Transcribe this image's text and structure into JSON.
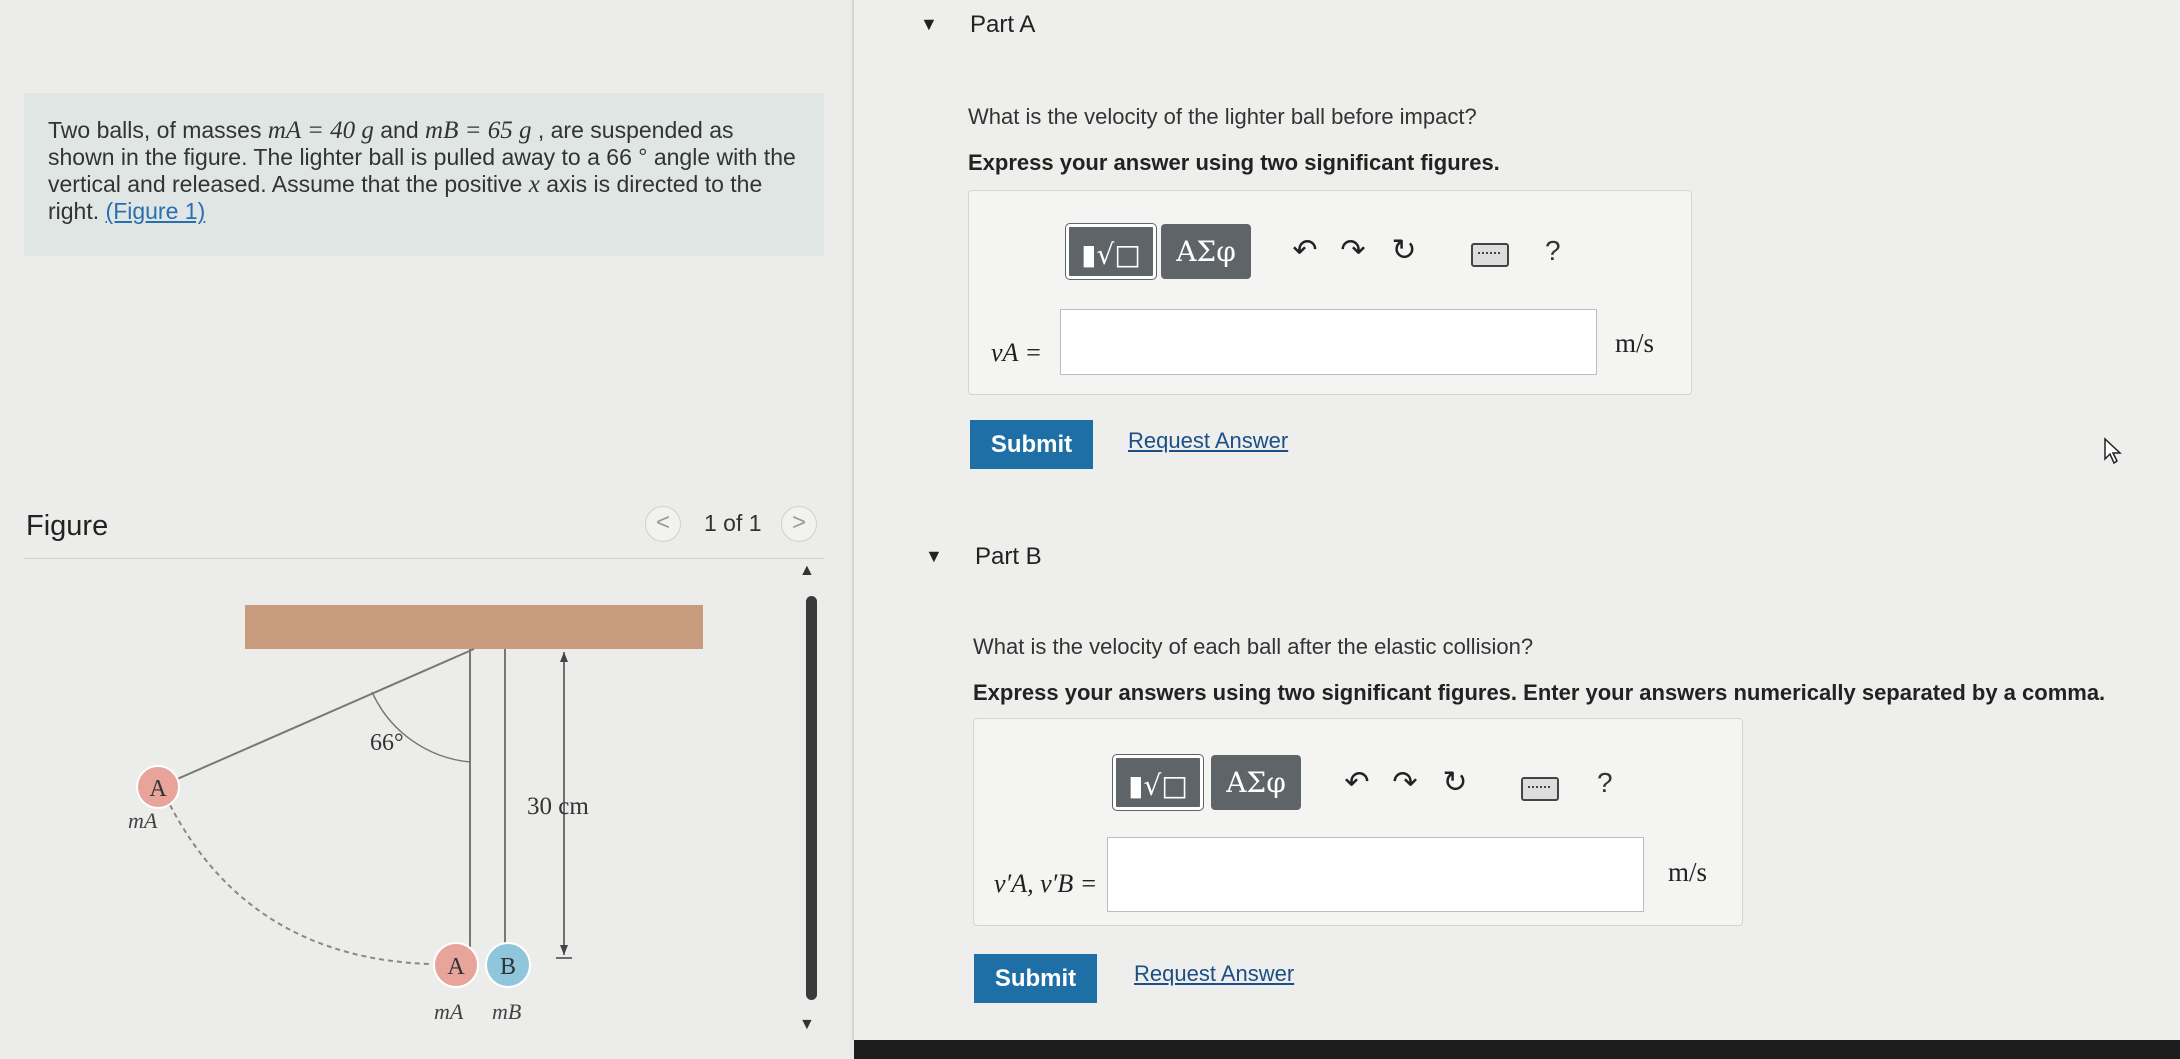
{
  "problem": {
    "t1": "Two balls, of masses ",
    "mA": "mA = 40 g",
    "t2": " and ",
    "mB": "mB = 65 g",
    "t3": " , are suspended as shown in the figure. The lighter ball is pulled away to a 66 ° angle with the vertical and released. Assume that the positive ",
    "x": "x",
    "t4": " axis is directed to the right. ",
    "figure_link": "(Figure 1)"
  },
  "figure": {
    "title": "Figure",
    "count": "1 of 1",
    "prev": "<",
    "next": ">",
    "angle_label": "66°",
    "length_label": "30 cm",
    "ball_A": "A",
    "ball_B": "B",
    "mass_A": "mA",
    "mass_B": "mB"
  },
  "part_a": {
    "heading": "Part A",
    "question": "What is the velocity of the lighter ball before impact?",
    "instruction": "Express your answer using two significant figures.",
    "var_label": "vA =",
    "unit": "m/s",
    "value": "",
    "submit": "Submit",
    "request": "Request Answer"
  },
  "part_b": {
    "heading": "Part B",
    "question": "What is the velocity of each ball after the elastic collision?",
    "instruction": "Express your answers using two significant figures. Enter your answers numerically separated by a comma.",
    "var_label": "v′A, v′B =",
    "unit": "m/s",
    "value": "",
    "submit": "Submit",
    "request": "Request Answer"
  },
  "toolbar": {
    "template": "▮√□",
    "symbols": "ΑΣφ",
    "undo": "↶",
    "redo": "↷",
    "reset": "↻",
    "help": "?"
  },
  "colors": {
    "ball": "#e8a39a",
    "ball_B": "#8fc6dc",
    "ceiling": "#c89a7e",
    "submit": "#1d6fa5",
    "problem_bg": "#dfe6e3"
  }
}
